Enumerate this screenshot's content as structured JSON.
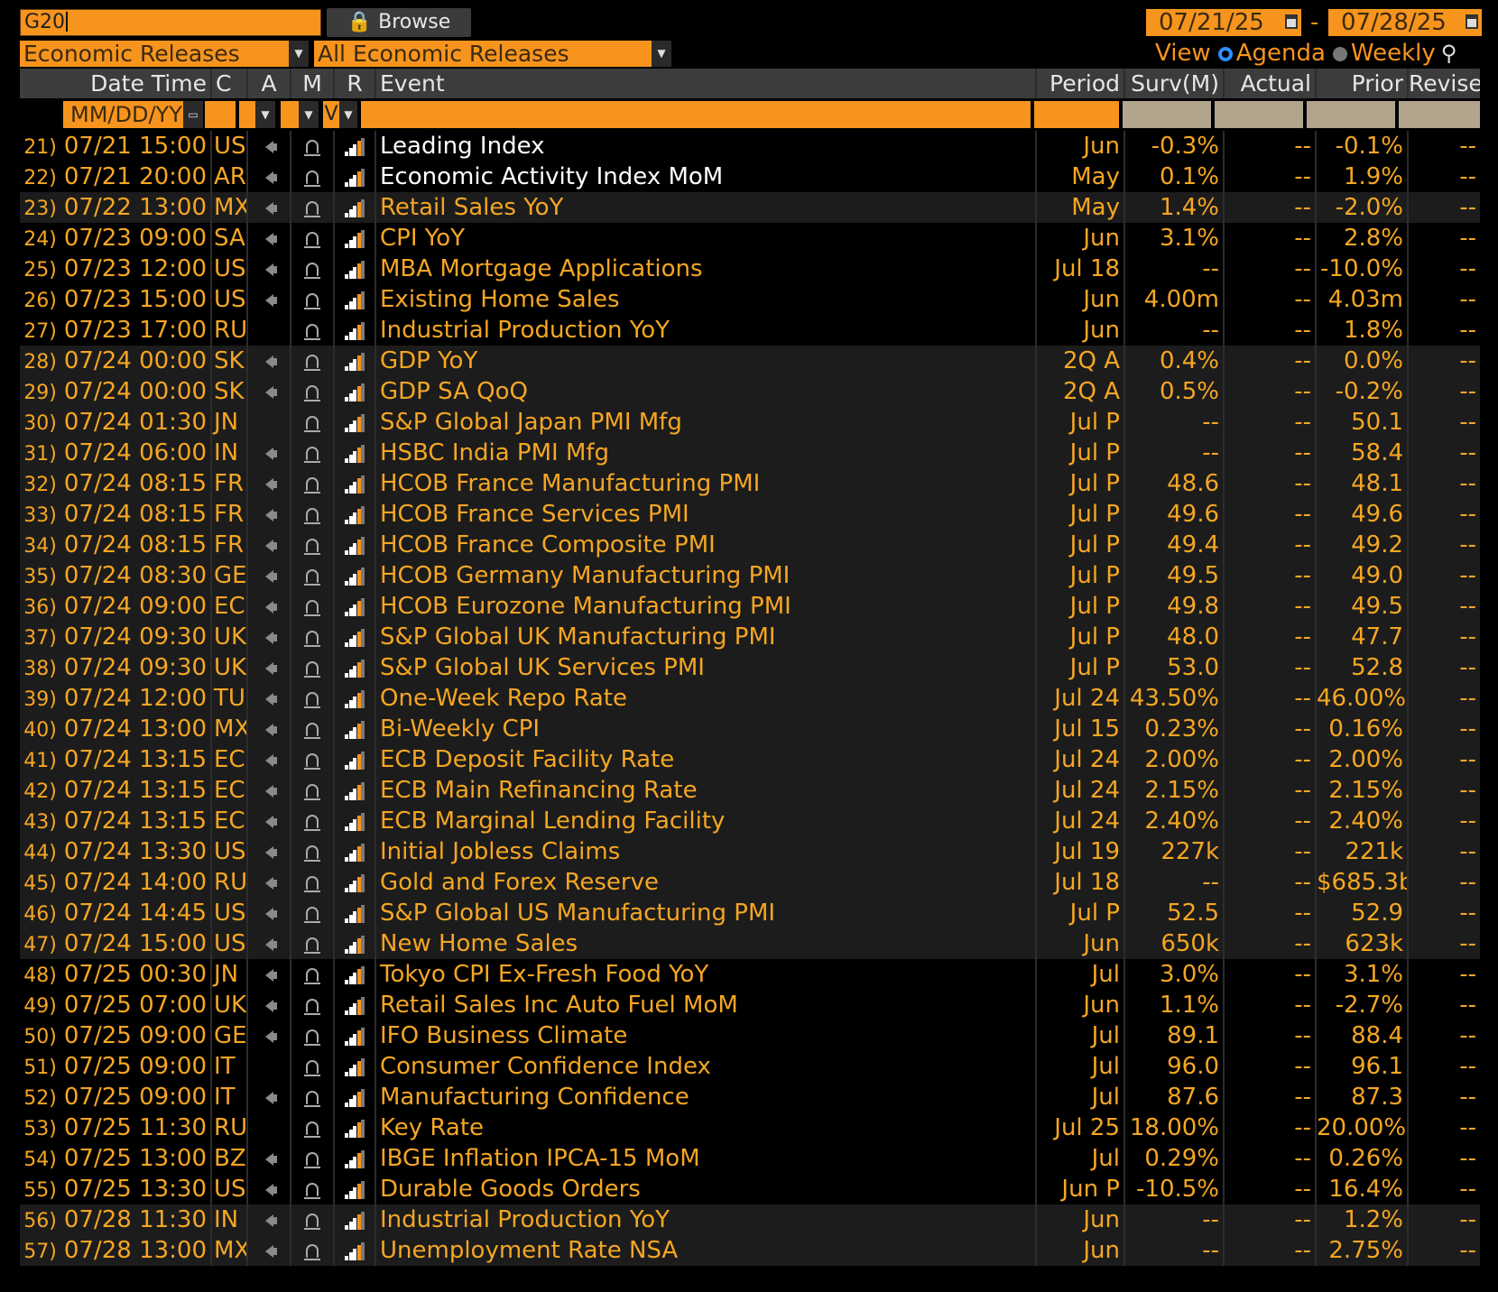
{
  "security": "G20",
  "browse_label": "🔒 Browse",
  "date_from": "07/21/25",
  "date_to": "07/28/25",
  "date_separator": "-",
  "source_dropdown": "Economic Releases",
  "type_dropdown": "All Economic Releases",
  "view": {
    "label": "View",
    "agenda": "Agenda",
    "weekly": "Weekly",
    "selected": "Agenda"
  },
  "columns": {
    "datetime": "Date Time",
    "c": "C",
    "a": "A",
    "m": "M",
    "r": "R",
    "event": "Event",
    "period": "Period",
    "surv": "Surv(M)",
    "actual": "Actual",
    "prior": "Prior",
    "revised": "Revised"
  },
  "filters": {
    "date_placeholder": "MM/DD/YY",
    "r_value": "V"
  },
  "colors": {
    "accent": "#f7941d",
    "text_orange": "#f5a623",
    "text_white": "#ffffff",
    "band_dark": "#000000",
    "band_gray": "#1c1c1c",
    "header_bg": "#3c3c3c",
    "bar_white": "#ffffff",
    "bar_orange": "#f7941d",
    "bar_gray": "#7a7a7a"
  },
  "rows": [
    {
      "num": "21)",
      "date": "07/21",
      "time": "15:00",
      "c": "US",
      "a": true,
      "event": "Leading Index",
      "period": "Jun",
      "surv": "-0.3%",
      "actual": "--",
      "prior": "-0.1%",
      "revised": "--",
      "band": 0,
      "white": true
    },
    {
      "num": "22)",
      "date": "07/21",
      "time": "20:00",
      "c": "AR",
      "a": true,
      "event": "Economic Activity Index MoM",
      "period": "May",
      "surv": "0.1%",
      "actual": "--",
      "prior": "1.9%",
      "revised": "--",
      "band": 0,
      "white": true
    },
    {
      "num": "23)",
      "date": "07/22",
      "time": "13:00",
      "c": "MX",
      "a": true,
      "event": "Retail Sales YoY",
      "period": "May",
      "surv": "1.4%",
      "actual": "--",
      "prior": "-2.0%",
      "revised": "--",
      "band": 1
    },
    {
      "num": "24)",
      "date": "07/23",
      "time": "09:00",
      "c": "SA",
      "a": true,
      "event": "CPI YoY",
      "period": "Jun",
      "surv": "3.1%",
      "actual": "--",
      "prior": "2.8%",
      "revised": "--",
      "band": 0
    },
    {
      "num": "25)",
      "date": "07/23",
      "time": "12:00",
      "c": "US",
      "a": true,
      "event": "MBA Mortgage Applications",
      "period": "Jul 18",
      "surv": "--",
      "actual": "--",
      "prior": "-10.0%",
      "revised": "--",
      "band": 0
    },
    {
      "num": "26)",
      "date": "07/23",
      "time": "15:00",
      "c": "US",
      "a": true,
      "event": "Existing Home Sales",
      "period": "Jun",
      "surv": "4.00m",
      "actual": "--",
      "prior": "4.03m",
      "revised": "--",
      "band": 0
    },
    {
      "num": "27)",
      "date": "07/23",
      "time": "17:00",
      "c": "RU",
      "a": false,
      "event": "Industrial Production YoY",
      "period": "Jun",
      "surv": "--",
      "actual": "--",
      "prior": "1.8%",
      "revised": "--",
      "band": 0
    },
    {
      "num": "28)",
      "date": "07/24",
      "time": "00:00",
      "c": "SK",
      "a": true,
      "event": "GDP YoY",
      "period": "2Q A",
      "surv": "0.4%",
      "actual": "--",
      "prior": "0.0%",
      "revised": "--",
      "band": 1
    },
    {
      "num": "29)",
      "date": "07/24",
      "time": "00:00",
      "c": "SK",
      "a": true,
      "event": "GDP SA QoQ",
      "period": "2Q A",
      "surv": "0.5%",
      "actual": "--",
      "prior": "-0.2%",
      "revised": "--",
      "band": 1
    },
    {
      "num": "30)",
      "date": "07/24",
      "time": "01:30",
      "c": "JN",
      "a": false,
      "event": "S&P Global Japan PMI Mfg",
      "period": "Jul P",
      "surv": "--",
      "actual": "--",
      "prior": "50.1",
      "revised": "--",
      "band": 1
    },
    {
      "num": "31)",
      "date": "07/24",
      "time": "06:00",
      "c": "IN",
      "a": true,
      "event": "HSBC India PMI Mfg",
      "period": "Jul P",
      "surv": "--",
      "actual": "--",
      "prior": "58.4",
      "revised": "--",
      "band": 1
    },
    {
      "num": "32)",
      "date": "07/24",
      "time": "08:15",
      "c": "FR",
      "a": true,
      "event": "HCOB France Manufacturing PMI",
      "period": "Jul P",
      "surv": "48.6",
      "actual": "--",
      "prior": "48.1",
      "revised": "--",
      "band": 1
    },
    {
      "num": "33)",
      "date": "07/24",
      "time": "08:15",
      "c": "FR",
      "a": true,
      "event": "HCOB France Services PMI",
      "period": "Jul P",
      "surv": "49.6",
      "actual": "--",
      "prior": "49.6",
      "revised": "--",
      "band": 1
    },
    {
      "num": "34)",
      "date": "07/24",
      "time": "08:15",
      "c": "FR",
      "a": true,
      "event": "HCOB France Composite PMI",
      "period": "Jul P",
      "surv": "49.4",
      "actual": "--",
      "prior": "49.2",
      "revised": "--",
      "band": 1
    },
    {
      "num": "35)",
      "date": "07/24",
      "time": "08:30",
      "c": "GE",
      "a": true,
      "event": "HCOB Germany Manufacturing PMI",
      "period": "Jul P",
      "surv": "49.5",
      "actual": "--",
      "prior": "49.0",
      "revised": "--",
      "band": 1
    },
    {
      "num": "36)",
      "date": "07/24",
      "time": "09:00",
      "c": "EC",
      "a": true,
      "event": "HCOB Eurozone Manufacturing PMI",
      "period": "Jul P",
      "surv": "49.8",
      "actual": "--",
      "prior": "49.5",
      "revised": "--",
      "band": 1
    },
    {
      "num": "37)",
      "date": "07/24",
      "time": "09:30",
      "c": "UK",
      "a": true,
      "event": "S&P Global UK Manufacturing PMI",
      "period": "Jul P",
      "surv": "48.0",
      "actual": "--",
      "prior": "47.7",
      "revised": "--",
      "band": 1
    },
    {
      "num": "38)",
      "date": "07/24",
      "time": "09:30",
      "c": "UK",
      "a": true,
      "event": "S&P Global UK Services PMI",
      "period": "Jul P",
      "surv": "53.0",
      "actual": "--",
      "prior": "52.8",
      "revised": "--",
      "band": 1
    },
    {
      "num": "39)",
      "date": "07/24",
      "time": "12:00",
      "c": "TU",
      "a": true,
      "event": "One-Week Repo Rate",
      "period": "Jul 24",
      "surv": "43.50%",
      "actual": "--",
      "prior": "46.00%",
      "revised": "--",
      "band": 1
    },
    {
      "num": "40)",
      "date": "07/24",
      "time": "13:00",
      "c": "MX",
      "a": true,
      "event": "Bi-Weekly CPI",
      "period": "Jul 15",
      "surv": "0.23%",
      "actual": "--",
      "prior": "0.16%",
      "revised": "--",
      "band": 1
    },
    {
      "num": "41)",
      "date": "07/24",
      "time": "13:15",
      "c": "EC",
      "a": true,
      "event": "ECB Deposit Facility Rate",
      "period": "Jul 24",
      "surv": "2.00%",
      "actual": "--",
      "prior": "2.00%",
      "revised": "--",
      "band": 1
    },
    {
      "num": "42)",
      "date": "07/24",
      "time": "13:15",
      "c": "EC",
      "a": true,
      "event": "ECB Main Refinancing Rate",
      "period": "Jul 24",
      "surv": "2.15%",
      "actual": "--",
      "prior": "2.15%",
      "revised": "--",
      "band": 1
    },
    {
      "num": "43)",
      "date": "07/24",
      "time": "13:15",
      "c": "EC",
      "a": true,
      "event": "ECB Marginal Lending Facility",
      "period": "Jul 24",
      "surv": "2.40%",
      "actual": "--",
      "prior": "2.40%",
      "revised": "--",
      "band": 1
    },
    {
      "num": "44)",
      "date": "07/24",
      "time": "13:30",
      "c": "US",
      "a": true,
      "event": "Initial Jobless Claims",
      "period": "Jul 19",
      "surv": "227k",
      "actual": "--",
      "prior": "221k",
      "revised": "--",
      "band": 1
    },
    {
      "num": "45)",
      "date": "07/24",
      "time": "14:00",
      "c": "RU",
      "a": true,
      "event": "Gold and Forex Reserve",
      "period": "Jul 18",
      "surv": "--",
      "actual": "--",
      "prior": "$685.3b",
      "revised": "--",
      "band": 1
    },
    {
      "num": "46)",
      "date": "07/24",
      "time": "14:45",
      "c": "US",
      "a": true,
      "event": "S&P Global US Manufacturing PMI",
      "period": "Jul P",
      "surv": "52.5",
      "actual": "--",
      "prior": "52.9",
      "revised": "--",
      "band": 1
    },
    {
      "num": "47)",
      "date": "07/24",
      "time": "15:00",
      "c": "US",
      "a": true,
      "event": "New Home Sales",
      "period": "Jun",
      "surv": "650k",
      "actual": "--",
      "prior": "623k",
      "revised": "--",
      "band": 1
    },
    {
      "num": "48)",
      "date": "07/25",
      "time": "00:30",
      "c": "JN",
      "a": true,
      "event": "Tokyo CPI Ex-Fresh Food YoY",
      "period": "Jul",
      "surv": "3.0%",
      "actual": "--",
      "prior": "3.1%",
      "revised": "--",
      "band": 0
    },
    {
      "num": "49)",
      "date": "07/25",
      "time": "07:00",
      "c": "UK",
      "a": true,
      "event": "Retail Sales Inc Auto Fuel MoM",
      "period": "Jun",
      "surv": "1.1%",
      "actual": "--",
      "prior": "-2.7%",
      "revised": "--",
      "band": 0
    },
    {
      "num": "50)",
      "date": "07/25",
      "time": "09:00",
      "c": "GE",
      "a": true,
      "event": "IFO Business Climate",
      "period": "Jul",
      "surv": "89.1",
      "actual": "--",
      "prior": "88.4",
      "revised": "--",
      "band": 0
    },
    {
      "num": "51)",
      "date": "07/25",
      "time": "09:00",
      "c": "IT",
      "a": false,
      "event": "Consumer Confidence Index",
      "period": "Jul",
      "surv": "96.0",
      "actual": "--",
      "prior": "96.1",
      "revised": "--",
      "band": 0
    },
    {
      "num": "52)",
      "date": "07/25",
      "time": "09:00",
      "c": "IT",
      "a": true,
      "event": "Manufacturing Confidence",
      "period": "Jul",
      "surv": "87.6",
      "actual": "--",
      "prior": "87.3",
      "revised": "--",
      "band": 0
    },
    {
      "num": "53)",
      "date": "07/25",
      "time": "11:30",
      "c": "RU",
      "a": false,
      "event": "Key Rate",
      "period": "Jul 25",
      "surv": "18.00%",
      "actual": "--",
      "prior": "20.00%",
      "revised": "--",
      "band": 0
    },
    {
      "num": "54)",
      "date": "07/25",
      "time": "13:00",
      "c": "BZ",
      "a": true,
      "event": "IBGE Inflation IPCA-15 MoM",
      "period": "Jul",
      "surv": "0.29%",
      "actual": "--",
      "prior": "0.26%",
      "revised": "--",
      "band": 0
    },
    {
      "num": "55)",
      "date": "07/25",
      "time": "13:30",
      "c": "US",
      "a": true,
      "event": "Durable Goods Orders",
      "period": "Jun P",
      "surv": "-10.5%",
      "actual": "--",
      "prior": "16.4%",
      "revised": "--",
      "band": 0
    },
    {
      "num": "56)",
      "date": "07/28",
      "time": "11:30",
      "c": "IN",
      "a": true,
      "event": "Industrial Production YoY",
      "period": "Jun",
      "surv": "--",
      "actual": "--",
      "prior": "1.2%",
      "revised": "--",
      "band": 1
    },
    {
      "num": "57)",
      "date": "07/28",
      "time": "13:00",
      "c": "MX",
      "a": true,
      "event": "Unemployment Rate NSA",
      "period": "Jun",
      "surv": "--",
      "actual": "--",
      "prior": "2.75%",
      "revised": "--",
      "band": 1
    }
  ]
}
